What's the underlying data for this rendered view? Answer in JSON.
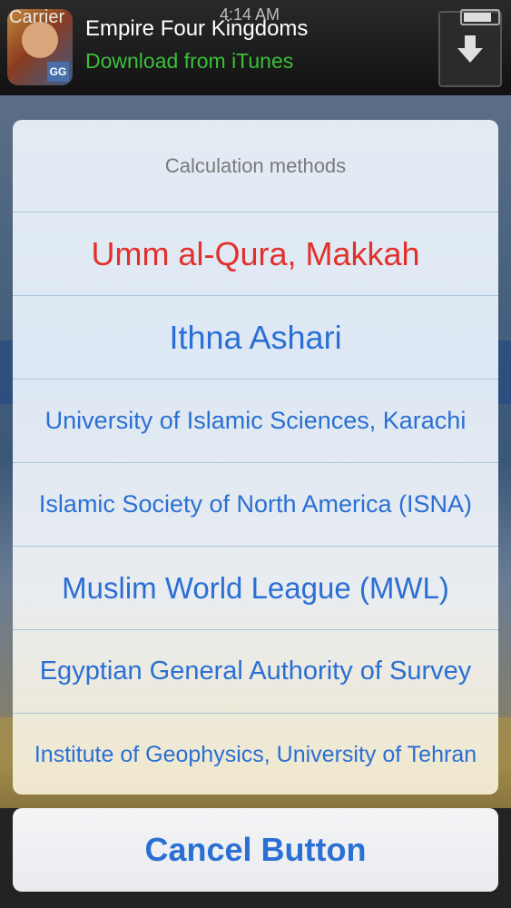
{
  "status_bar": {
    "carrier": "Carrier",
    "time": "4:14 AM"
  },
  "ad": {
    "title": "Empire Four Kingdoms",
    "subtitle": "Download from iTunes",
    "icon_badge": "GG",
    "download_icon": "download-arrow-icon"
  },
  "action_sheet": {
    "title": "Calculation methods",
    "options": [
      {
        "label": "Umm al-Qura, Makkah",
        "color": "#e2302c"
      },
      {
        "label": "Ithna Ashari",
        "color": "#2a6fd4"
      },
      {
        "label": "University of Islamic Sciences, Karachi",
        "color": "#2a6fd4"
      },
      {
        "label": "Islamic Society of North America (ISNA)",
        "color": "#2a6fd4"
      },
      {
        "label": "Muslim World League (MWL)",
        "color": "#2a6fd4"
      },
      {
        "label": "Egyptian General Authority of Survey",
        "color": "#2a6fd4"
      },
      {
        "label": "Institute of Geophysics, University of Tehran",
        "color": "#2a6fd4"
      }
    ],
    "cancel_label": "Cancel Button",
    "cancel_color": "#2a6fd4"
  }
}
